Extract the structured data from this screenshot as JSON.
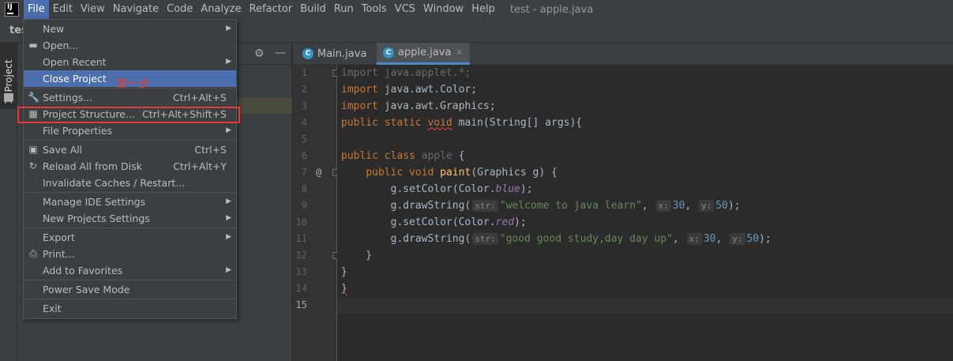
{
  "menubar": {
    "items": [
      "File",
      "Edit",
      "View",
      "Navigate",
      "Code",
      "Analyze",
      "Refactor",
      "Build",
      "Run",
      "Tools",
      "VCS",
      "Window",
      "Help"
    ],
    "window_title": "test - apple.java"
  },
  "toolbar": {
    "project_name": "tes"
  },
  "tool_strip": {
    "project_tab_label": "1: Project"
  },
  "editor": {
    "tabs": [
      {
        "label": "Main.java",
        "selected": false
      },
      {
        "label": "apple.java",
        "selected": true
      }
    ],
    "line_numbers": [
      "1",
      "2",
      "3",
      "4",
      "5",
      "6",
      "7",
      "8",
      "9",
      "10",
      "11",
      "12",
      "13",
      "14",
      "15"
    ],
    "gutter_marker_line7": "@"
  },
  "file_menu": {
    "items": [
      {
        "label": "New",
        "shortcut": "",
        "submenu": true,
        "icon": ""
      },
      {
        "label": "Open...",
        "shortcut": "",
        "submenu": false,
        "icon": "folder-open-icon"
      },
      {
        "label": "Open Recent",
        "shortcut": "",
        "submenu": true,
        "icon": ""
      },
      {
        "label": "Close Project",
        "shortcut": "",
        "submenu": false,
        "icon": "",
        "highlighted": true
      },
      {
        "label": "Settings...",
        "shortcut": "Ctrl+Alt+S",
        "submenu": false,
        "icon": "wrench-icon"
      },
      {
        "label": "Project Structure...",
        "shortcut": "Ctrl+Alt+Shift+S",
        "submenu": false,
        "icon": "project-structure-icon"
      },
      {
        "label": "File Properties",
        "shortcut": "",
        "submenu": true,
        "icon": ""
      },
      {
        "label": "Save All",
        "shortcut": "Ctrl+S",
        "submenu": false,
        "icon": "save-icon"
      },
      {
        "label": "Reload All from Disk",
        "shortcut": "Ctrl+Alt+Y",
        "submenu": false,
        "icon": "reload-icon"
      },
      {
        "label": "Invalidate Caches / Restart...",
        "shortcut": "",
        "submenu": false,
        "icon": ""
      },
      {
        "label": "Manage IDE Settings",
        "shortcut": "",
        "submenu": true,
        "icon": ""
      },
      {
        "label": "New Projects Settings",
        "shortcut": "",
        "submenu": true,
        "icon": ""
      },
      {
        "label": "Export",
        "shortcut": "",
        "submenu": true,
        "icon": ""
      },
      {
        "label": "Print...",
        "shortcut": "",
        "submenu": false,
        "icon": "print-icon"
      },
      {
        "label": "Add to Favorites",
        "shortcut": "",
        "submenu": true,
        "icon": ""
      },
      {
        "label": "Power Save Mode",
        "shortcut": "",
        "submenu": false,
        "icon": ""
      },
      {
        "label": "Exit",
        "shortcut": "",
        "submenu": false,
        "icon": ""
      }
    ]
  },
  "annotation": {
    "step_label": "第一步"
  },
  "colors": {
    "menu_highlight": "#4b6eaf",
    "annotation_red": "#e53935",
    "keyword": "#cc7832",
    "string": "#6a8759",
    "number": "#6897bb"
  }
}
